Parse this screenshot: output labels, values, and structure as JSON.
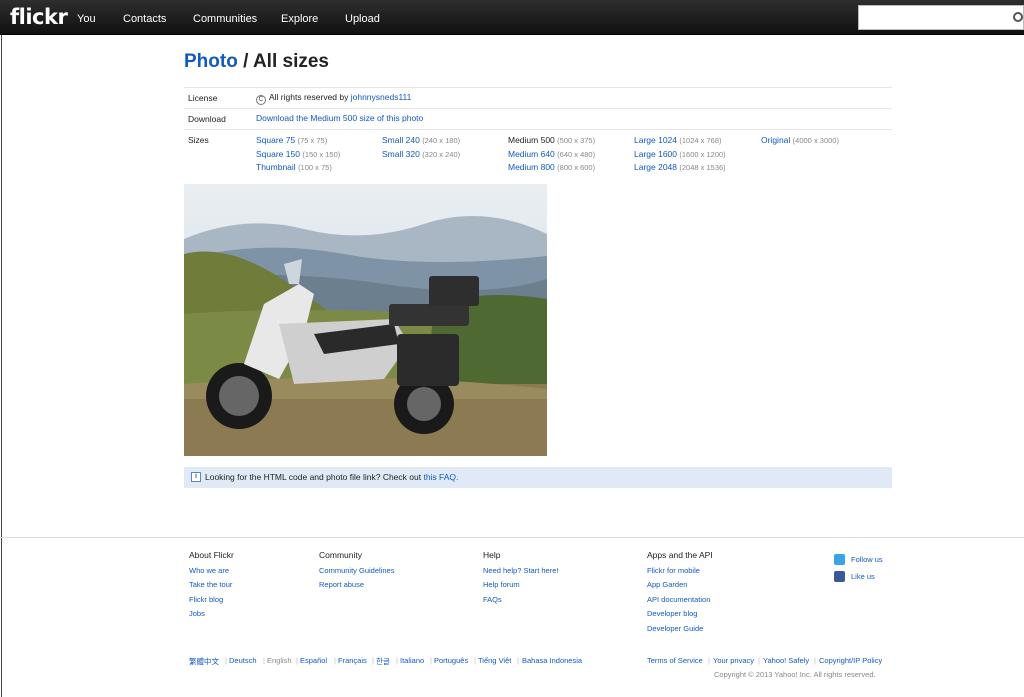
{
  "header": {
    "logo": "flickr",
    "nav": [
      "You",
      "Contacts",
      "Communities",
      "Explore",
      "Upload"
    ],
    "search_placeholder": ""
  },
  "page": {
    "title_link": "Photo",
    "title_rest": " / All sizes"
  },
  "info": {
    "license_label": "License",
    "license_text": "All rights reserved by ",
    "license_user": "johnnysneds111",
    "download_label": "Download",
    "download_link": "Download the Medium 500 size of this photo",
    "sizes_label": "Sizes"
  },
  "sizes": [
    {
      "name": "Square 75",
      "dim": "(75 x 75)",
      "current": false
    },
    {
      "name": "Square 150",
      "dim": "(150 x 150)",
      "current": false
    },
    {
      "name": "Thumbnail",
      "dim": "(100 x 75)",
      "current": false
    },
    {
      "name": "Small 240",
      "dim": "(240 x 180)",
      "current": false
    },
    {
      "name": "Small 320",
      "dim": "(320 x 240)",
      "current": false
    },
    {
      "name": "Medium 500",
      "dim": "(500 x 375)",
      "current": true
    },
    {
      "name": "Medium 640",
      "dim": "(640 x 480)",
      "current": false
    },
    {
      "name": "Medium 800",
      "dim": "(800 x 600)",
      "current": false
    },
    {
      "name": "Large 1024",
      "dim": "(1024 x 768)",
      "current": false
    },
    {
      "name": "Large 1600",
      "dim": "(1600 x 1200)",
      "current": false
    },
    {
      "name": "Large 2048",
      "dim": "(2048 x 1536)",
      "current": false
    },
    {
      "name": "Original",
      "dim": "(4000 x 3000)",
      "current": false
    }
  ],
  "banner": {
    "text": "Looking for the HTML code and photo file link? Check out ",
    "link": "this FAQ."
  },
  "footer": {
    "about": {
      "heading": "About Flickr",
      "links": [
        "Who we are",
        "Take the tour",
        "Flickr blog",
        "Jobs"
      ]
    },
    "community": {
      "heading": "Community",
      "links": [
        "Community Guidelines",
        "Report abuse"
      ]
    },
    "help": {
      "heading": "Help",
      "links": [
        "Need help? Start here!",
        "Help forum",
        "FAQs"
      ]
    },
    "apps": {
      "heading": "Apps and the API",
      "links": [
        "Flickr for mobile",
        "App Garden",
        "API documentation",
        "Developer blog",
        "Developer Guide"
      ]
    },
    "social": {
      "follow": "Follow us",
      "like": "Like us"
    },
    "languages": [
      "繁體中文",
      "Deutsch",
      "English",
      "Español",
      "Français",
      "한글",
      "Italiano",
      "Português",
      "Tiếng Việt",
      "Bahasa Indonesia"
    ],
    "legal": [
      "Terms of Service",
      "Your privacy",
      "Yahoo! Safely",
      "Copyright/IP Policy"
    ],
    "copyright": "Copyright © 2013 Yahoo! Inc. All rights reserved."
  },
  "colors": {
    "link": "#1259c3",
    "banner_bg": "#e0eaf6",
    "topbar": "#1a1a1a"
  }
}
